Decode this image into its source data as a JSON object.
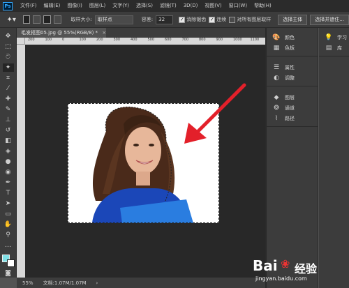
{
  "app": {
    "logo": "Ps"
  },
  "menu": [
    "文件(F)",
    "编辑(E)",
    "图像(I)",
    "图层(L)",
    "文字(Y)",
    "选择(S)",
    "滤镜(T)",
    "3D(D)",
    "视图(V)",
    "窗口(W)",
    "帮助(H)"
  ],
  "options": {
    "sample_size_label": "取样大小:",
    "sample_size_value": "取样点",
    "tolerance_label": "容差:",
    "tolerance_value": "32",
    "antialias_label": "消除锯齿",
    "contiguous_label": "连续",
    "sample_all_label": "对所有图层取样",
    "select_subject_label": "选择主体",
    "select_mask_label": "选择并遮住..."
  },
  "document": {
    "tab_title": "毛发抠图05.jpg @ 55%(RGB/8) *",
    "ruler_ticks": [
      "200",
      "100",
      "0",
      "100",
      "200",
      "300",
      "400",
      "500",
      "600",
      "700",
      "800",
      "900",
      "1000",
      "1100"
    ]
  },
  "status": {
    "zoom": "55%",
    "doc_info": "文档:1.07M/1.07M"
  },
  "panels": {
    "group1": [
      {
        "icon": "palette-icon",
        "label": "颜色"
      },
      {
        "icon": "swatches-icon",
        "label": "色板"
      }
    ],
    "group2": [
      {
        "icon": "properties-icon",
        "label": "属性"
      },
      {
        "icon": "adjustments-icon",
        "label": "调整"
      }
    ],
    "group3": [
      {
        "icon": "layers-icon",
        "label": "图层"
      },
      {
        "icon": "channels-icon",
        "label": "通道"
      },
      {
        "icon": "paths-icon",
        "label": "路径"
      }
    ],
    "side": [
      {
        "icon": "learn-icon",
        "label": "学习"
      },
      {
        "icon": "libraries-icon",
        "label": "库"
      }
    ]
  },
  "colors": {
    "foreground": "#7fe0e6",
    "background": "#ffffff",
    "arrow": "#e3202a"
  },
  "watermark": {
    "brand": "Bai",
    "brand2": "经验",
    "url": "jingyan.baidu.com"
  }
}
